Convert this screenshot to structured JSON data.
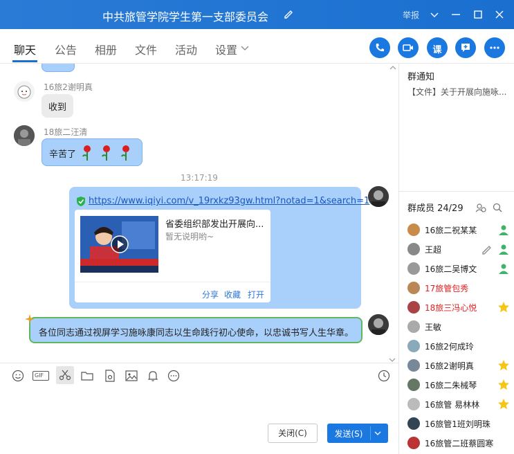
{
  "window": {
    "title": "中共旅管学院学生第一支部委员会",
    "report_label": "举报"
  },
  "tabs": [
    {
      "label": "聊天"
    },
    {
      "label": "公告"
    },
    {
      "label": "相册"
    },
    {
      "label": "文件"
    },
    {
      "label": "活动"
    },
    {
      "label": "设置"
    }
  ],
  "header_actions": {
    "lesson_label": "课"
  },
  "chat": {
    "messages": [
      {
        "sender": "16旅2谢明真",
        "text": "收到"
      },
      {
        "sender": "18旅二汪清",
        "text": "辛苦了"
      }
    ],
    "timestamp": "13:17:19",
    "link_message": {
      "url": "https://www.iqiyi.com/v_19rxkz93gw.html?notad=1&search=1",
      "card_title": "省委组织部发出开展向...",
      "card_desc": "暂无说明哟~",
      "actions": [
        "分享",
        "收藏",
        "打开"
      ]
    },
    "banner_message": "各位同志通过视屏学习施咏康同志以生命践行初心使命，以忠诚书写人生华章。"
  },
  "composer": {
    "gif_label": "GIF",
    "close_label": "关闭(C)",
    "send_label": "发送(S)"
  },
  "sidebar": {
    "notice_title": "群通知",
    "notice_text": "【文件】关于开展向施咏...",
    "members_title": "群成员 24/29",
    "members": [
      {
        "name": "16旅二祝某某",
        "color": "#222222",
        "badge": "admin-icon"
      },
      {
        "name": "王超",
        "color": "#222222",
        "badge": "admin-icon"
      },
      {
        "name": "16旅二吴博文",
        "color": "#222222",
        "badge": "admin-icon"
      },
      {
        "name": "17旅管包秀",
        "color": "#e02020",
        "badge": ""
      },
      {
        "name": "18旅三冯心悦",
        "color": "#e02020",
        "badge": "star-icon"
      },
      {
        "name": "王敏",
        "color": "#222222",
        "badge": ""
      },
      {
        "name": "16旅2何成玲",
        "color": "#222222",
        "badge": ""
      },
      {
        "name": "16旅2谢明真",
        "color": "#222222",
        "badge": "star-icon"
      },
      {
        "name": "16旅二朱械琴",
        "color": "#222222",
        "badge": "star-icon"
      },
      {
        "name": "16旅管 易林林",
        "color": "#222222",
        "badge": "star-icon"
      },
      {
        "name": "16旅管1班刘明珠",
        "color": "#222222",
        "badge": ""
      },
      {
        "name": "16旅管二班蔡圆寒",
        "color": "#222222",
        "badge": ""
      }
    ]
  }
}
